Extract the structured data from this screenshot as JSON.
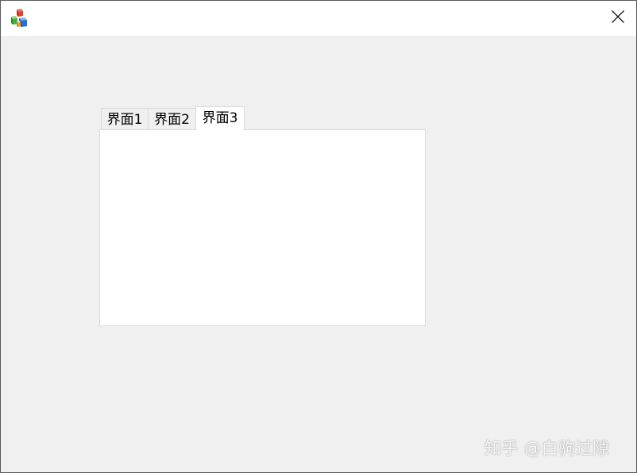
{
  "titlebar": {
    "app_icon": "colored-cubes-icon",
    "close_icon": "close-icon"
  },
  "tabs": [
    {
      "label": "界面1",
      "active": false
    },
    {
      "label": "界面2",
      "active": false
    },
    {
      "label": "界面3",
      "active": true
    }
  ],
  "watermark": {
    "text": "知乎 @白驹过隙"
  },
  "colors": {
    "window_bg": "#f0f0f0",
    "titlebar_bg": "#ffffff",
    "pane_bg": "#ffffff",
    "border": "#d9d9d9"
  }
}
